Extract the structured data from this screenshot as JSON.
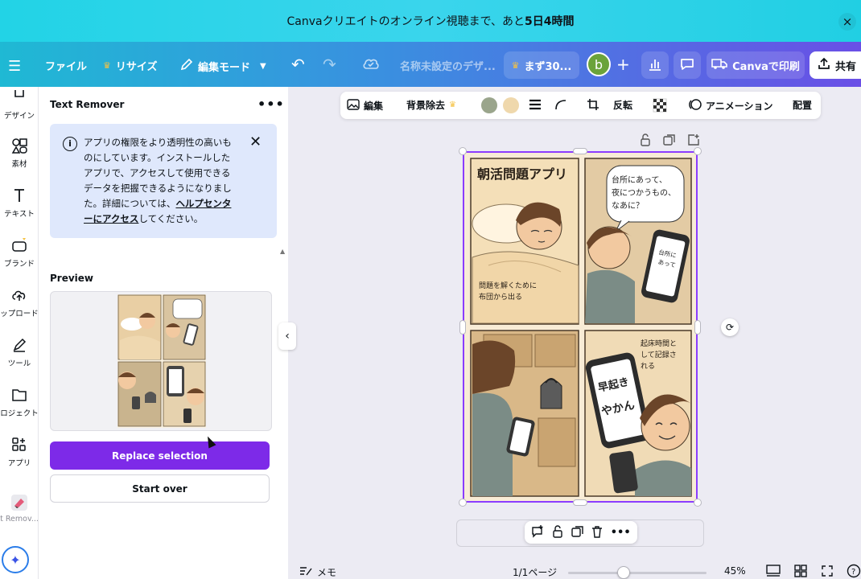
{
  "banner": {
    "text_prefix": "Canvaクリエイトのオンライン視聴まで、あと",
    "text_bold": "5日4時間",
    "close_icon": "×"
  },
  "toolbar": {
    "menu_icon": "☰",
    "file": "ファイル",
    "resize": "リサイズ",
    "edit_mode": "編集モード",
    "undo": "↶",
    "redo": "↷",
    "doc_title": "名称未設定のデザ...",
    "trial": "まず30...",
    "avatar_letter": "b",
    "add": "+",
    "print": "Canvaで印刷",
    "share": "共有"
  },
  "rail": {
    "items": [
      "デザイン",
      "素材",
      "テキスト",
      "ブランド",
      "ップロード",
      "ツール",
      "ロジェクト",
      "アプリ",
      "t Remov..."
    ]
  },
  "panel": {
    "title": "Text Remover",
    "more": "•••",
    "info_line1": "アプリの権限をより透明性の高いも",
    "info_line2": "のにしています。インストールした",
    "info_line3": "アプリで、アクセスして使用できる",
    "info_line4": "データを把握できるようになりまし",
    "info_line5a": "た。詳細については、",
    "info_link1": "ヘルプセンタ",
    "info_link2": "ーにアクセス",
    "info_line6": "してください。",
    "info_icon": "i",
    "close": "✕",
    "preview_label": "Preview",
    "replace_btn": "Replace selection",
    "start_over_btn": "Start over",
    "collapse": "‹"
  },
  "context_bar": {
    "edit": "編集",
    "bg_remove": "背景除去",
    "swatch1": "#9aa58c",
    "swatch2": "#efd8ac",
    "flip": "反転",
    "animation": "アニメーション",
    "position": "配置"
  },
  "comic": {
    "title": "朝活問題アプリ",
    "panel1_caption": "問題を解くために布団から出る",
    "panel2_bubble": "台所にあって、夜につかうもの、なあに？",
    "panel2_phone": "台所にあって夜につかうもの、なあに？",
    "panel4_caption": "起床時間として記録される",
    "panel4_phone_top": "早起き",
    "panel4_phone_answer": "やかん"
  },
  "bottom": {
    "notes": "メモ",
    "page": "1/1ページ",
    "zoom": "45%",
    "zoom_fraction": 0.37
  }
}
